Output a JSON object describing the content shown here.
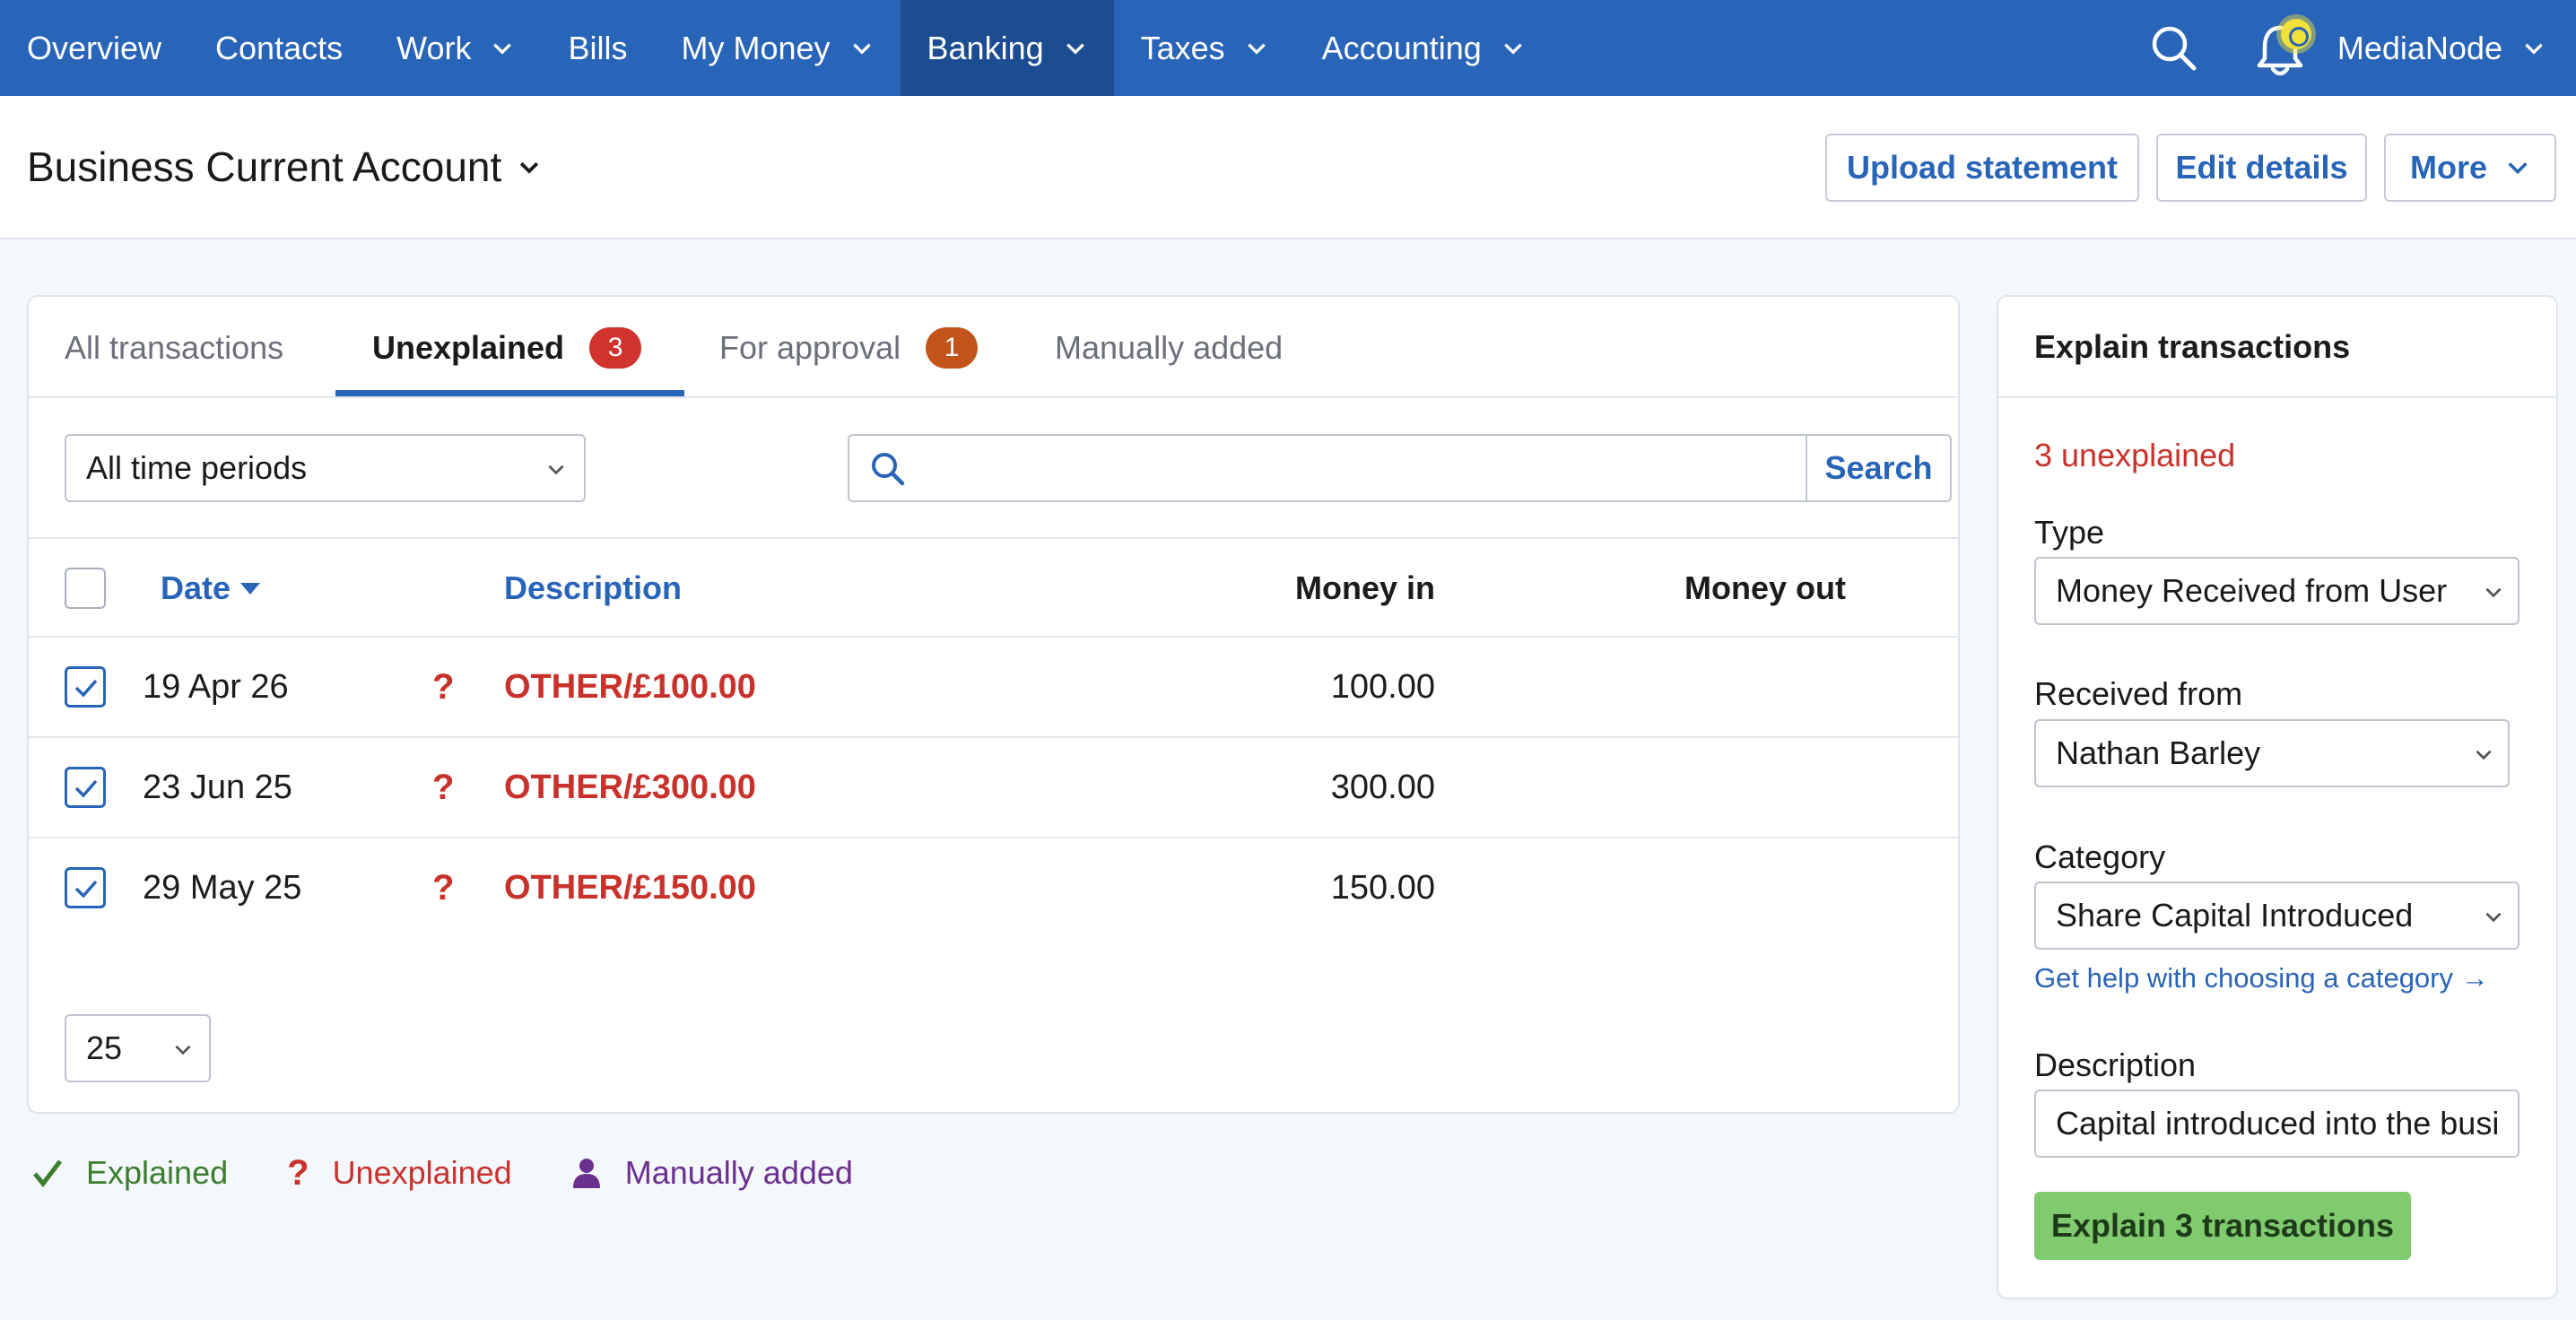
{
  "nav": {
    "items": [
      {
        "label": "Overview",
        "has_menu": false
      },
      {
        "label": "Contacts",
        "has_menu": false
      },
      {
        "label": "Work",
        "has_menu": true
      },
      {
        "label": "Bills",
        "has_menu": false
      },
      {
        "label": "My Money",
        "has_menu": true
      },
      {
        "label": "Banking",
        "has_menu": true,
        "active": true
      },
      {
        "label": "Taxes",
        "has_menu": true
      },
      {
        "label": "Accounting",
        "has_menu": true
      }
    ],
    "account_name": "MediaNode",
    "icons": [
      "search-icon",
      "bell-icon"
    ]
  },
  "header": {
    "title": "Business Current Account",
    "upload_label": "Upload statement",
    "edit_label": "Edit details",
    "more_label": "More"
  },
  "tabs": [
    {
      "label": "All transactions"
    },
    {
      "label": "Unexplained",
      "count": "3",
      "active": true
    },
    {
      "label": "For approval",
      "count": "1"
    },
    {
      "label": "Manually added"
    }
  ],
  "filters": {
    "period": "All time periods",
    "search_placeholder": "",
    "search_label": "Search"
  },
  "table": {
    "headers": {
      "date": "Date",
      "description": "Description",
      "money_in": "Money in",
      "money_out": "Money out"
    },
    "rows": [
      {
        "date": "19 Apr 26",
        "status": "?",
        "description": "OTHER/£100.00",
        "money_in": "100.00",
        "money_out": "",
        "checked": true
      },
      {
        "date": "23 Jun 25",
        "status": "?",
        "description": "OTHER/£300.00",
        "money_in": "300.00",
        "money_out": "",
        "checked": true
      },
      {
        "date": "29 May 25",
        "status": "?",
        "description": "OTHER/£150.00",
        "money_in": "150.00",
        "money_out": "",
        "checked": true
      }
    ],
    "page_size": "25"
  },
  "legend": {
    "explained": "Explained",
    "unexplained": "Unexplained",
    "manual": "Manually added"
  },
  "explain": {
    "title": "Explain transactions",
    "count_text": "3 unexplained",
    "type_label": "Type",
    "type_value": "Money Received from User",
    "received_label": "Received from",
    "received_value": "Nathan Barley",
    "category_label": "Category",
    "category_value": "Share Capital Introduced",
    "help_link": "Get help with choosing a category →",
    "description_label": "Description",
    "description_value": "Capital introduced into the business",
    "button_label": "Explain 3 transactions"
  },
  "colors": {
    "nav": "#2864b8",
    "nav_active": "#1c4d93",
    "unexplained_red": "#c9312b",
    "approval_orange": "#c2541a",
    "explained_green": "#3a7d2c",
    "manual_purple": "#6b2f8f",
    "explain_button": "#7fcb6e"
  }
}
